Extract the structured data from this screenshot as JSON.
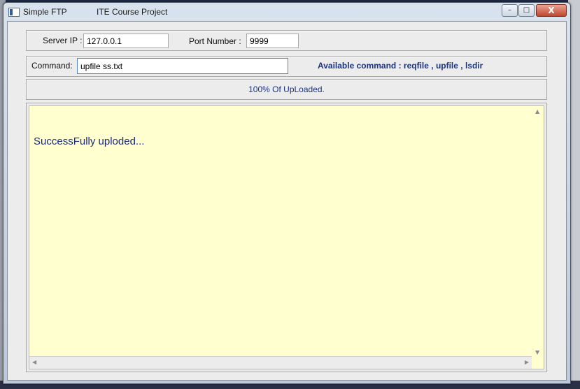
{
  "window": {
    "app_name": "Simple FTP",
    "subtitle": "ITE Course Project",
    "buttons": {
      "minimize": "–",
      "maximize": "□",
      "close": "X"
    }
  },
  "server": {
    "ip_label": "Server IP :",
    "ip_value": "127.0.0.1",
    "port_label": "Port Number :",
    "port_value": "9999"
  },
  "command": {
    "label": "Command:",
    "value": "upfile ss.txt",
    "available": "Available command :   reqfile  ,  upfile  ,  lsdir"
  },
  "status": {
    "text": "100%  Of    UpLoaded."
  },
  "output": {
    "text": "SuccessFully uploded..."
  },
  "icons": {
    "app": "ftp-app-icon",
    "scroll_up": "▲",
    "scroll_down": "▼",
    "scroll_left": "◀",
    "scroll_right": "▶"
  }
}
